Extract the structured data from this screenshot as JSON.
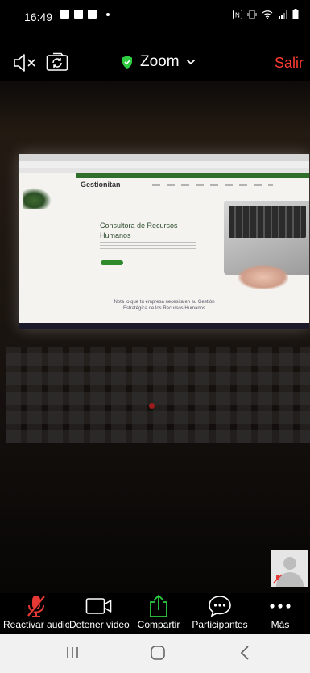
{
  "status_bar": {
    "time": "16:49",
    "left_icons": [
      "image-icon",
      "gmail-icon",
      "gmail-icon"
    ],
    "right_icons": [
      "nfc-icon",
      "vibrate-icon",
      "wifi-icon",
      "signal-icon",
      "battery-icon"
    ]
  },
  "top_bar": {
    "title": "Zoom",
    "leave_label": "Salir",
    "shield_color": "#2ecc40",
    "leave_color": "#ff3b30"
  },
  "shared_screen": {
    "site_logo": "Gestionitan",
    "hero_title": "Consultora de Recursos Humanos",
    "footer_text": "Nota lo que tu empresa necesita en su Gestión Estratégica de los Recursos Humanos"
  },
  "controls": {
    "items": [
      {
        "label": "Reactivar audio",
        "icon": "mic-muted-icon"
      },
      {
        "label": "Detener video",
        "icon": "video-camera-icon"
      },
      {
        "label": "Compartir",
        "icon": "share-arrow-icon"
      },
      {
        "label": "Participantes",
        "icon": "chat-bubble-icon"
      },
      {
        "label": "Más",
        "icon": "more-dots-icon"
      }
    ],
    "muted_color": "#e53935",
    "share_color": "#2ecc40"
  },
  "nav_bar": {
    "icons": [
      "recent-apps-icon",
      "home-icon",
      "back-icon"
    ]
  }
}
